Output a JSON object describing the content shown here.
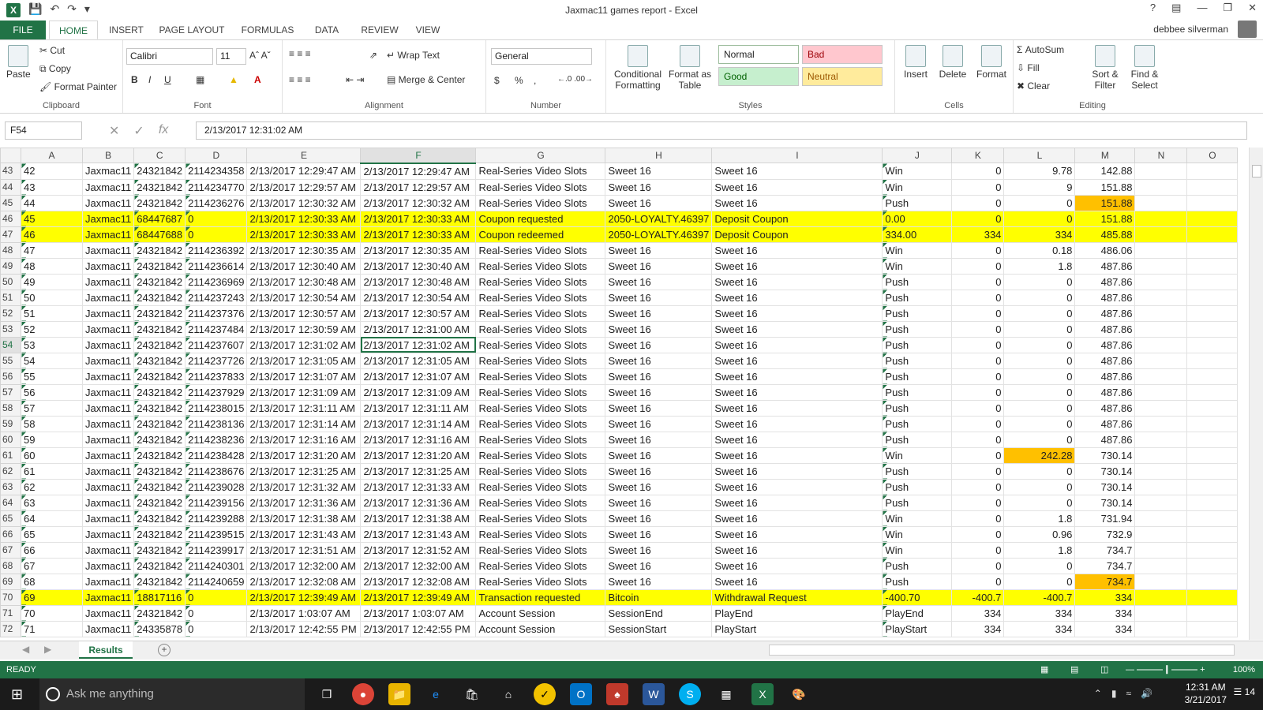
{
  "window": {
    "title": "Jaxmac11 games report - Excel",
    "user": "debbee silverman"
  },
  "tabs": [
    "FILE",
    "HOME",
    "INSERT",
    "PAGE LAYOUT",
    "FORMULAS",
    "DATA",
    "REVIEW",
    "VIEW"
  ],
  "ribbon": {
    "clipboard": {
      "label": "Clipboard",
      "paste": "Paste",
      "cut": "Cut",
      "copy": "Copy",
      "format_painter": "Format Painter"
    },
    "font": {
      "label": "Font",
      "name": "Calibri",
      "size": "11",
      "bold": "B",
      "italic": "I",
      "underline": "U"
    },
    "alignment": {
      "label": "Alignment",
      "wrap": "Wrap Text",
      "merge": "Merge & Center"
    },
    "number": {
      "label": "Number",
      "format": "General",
      "currency": "$",
      "percent": "%",
      "comma": ","
    },
    "styles": {
      "label": "Styles",
      "cond": "Conditional Formatting",
      "format_table": "Format as Table",
      "normal": "Normal",
      "bad": "Bad",
      "good": "Good",
      "neutral": "Neutral"
    },
    "cells": {
      "label": "Cells",
      "insert": "Insert",
      "delete": "Delete",
      "format": "Format"
    },
    "editing": {
      "label": "Editing",
      "autosum": "AutoSum",
      "fill": "Fill",
      "clear": "Clear",
      "sort": "Sort & Filter",
      "find": "Find & Select"
    }
  },
  "formula_bar": {
    "name_box": "F54",
    "formula": "2/13/2017 12:31:02 AM",
    "fx": "fx"
  },
  "columns": [
    "A",
    "B",
    "C",
    "D",
    "E",
    "F",
    "G",
    "H",
    "I",
    "J",
    "K",
    "L",
    "M",
    "N",
    "O"
  ],
  "rows": [
    {
      "r": "43",
      "c": [
        "42",
        "Jaxmac11",
        "24321842",
        "2114234358",
        "2/13/2017 12:29:47 AM",
        "2/13/2017 12:29:47 AM",
        "Real-Series Video Slots",
        "Sweet 16",
        "Sweet 16",
        "Win",
        "0",
        "9.78",
        "142.88"
      ]
    },
    {
      "r": "44",
      "c": [
        "43",
        "Jaxmac11",
        "24321842",
        "2114234770",
        "2/13/2017 12:29:57 AM",
        "2/13/2017 12:29:57 AM",
        "Real-Series Video Slots",
        "Sweet 16",
        "Sweet 16",
        "Win",
        "0",
        "9",
        "151.88"
      ]
    },
    {
      "r": "45",
      "c": [
        "44",
        "Jaxmac11",
        "24321842",
        "2114236276",
        "2/13/2017 12:30:32 AM",
        "2/13/2017 12:30:32 AM",
        "Real-Series Video Slots",
        "Sweet 16",
        "Sweet 16",
        "Push",
        "0",
        "0",
        "151.88"
      ],
      "orange": [
        12
      ]
    },
    {
      "r": "46",
      "c": [
        "45",
        "Jaxmac11",
        "68447687",
        "0",
        "2/13/2017 12:30:33 AM",
        "2/13/2017 12:30:33 AM",
        "Coupon requested",
        "2050-LOYALTY.46397",
        "Deposit Coupon",
        "0.00",
        "0",
        "0",
        "151.88"
      ],
      "hl": true
    },
    {
      "r": "47",
      "c": [
        "46",
        "Jaxmac11",
        "68447688",
        "0",
        "2/13/2017 12:30:33 AM",
        "2/13/2017 12:30:33 AM",
        "Coupon redeemed",
        "2050-LOYALTY.46397",
        "Deposit Coupon",
        "334.00",
        "334",
        "334",
        "485.88"
      ],
      "hl": true
    },
    {
      "r": "48",
      "c": [
        "47",
        "Jaxmac11",
        "24321842",
        "2114236392",
        "2/13/2017 12:30:35 AM",
        "2/13/2017 12:30:35 AM",
        "Real-Series Video Slots",
        "Sweet 16",
        "Sweet 16",
        "Win",
        "0",
        "0.18",
        "486.06"
      ]
    },
    {
      "r": "49",
      "c": [
        "48",
        "Jaxmac11",
        "24321842",
        "2114236614",
        "2/13/2017 12:30:40 AM",
        "2/13/2017 12:30:40 AM",
        "Real-Series Video Slots",
        "Sweet 16",
        "Sweet 16",
        "Win",
        "0",
        "1.8",
        "487.86"
      ]
    },
    {
      "r": "50",
      "c": [
        "49",
        "Jaxmac11",
        "24321842",
        "2114236969",
        "2/13/2017 12:30:48 AM",
        "2/13/2017 12:30:48 AM",
        "Real-Series Video Slots",
        "Sweet 16",
        "Sweet 16",
        "Push",
        "0",
        "0",
        "487.86"
      ]
    },
    {
      "r": "51",
      "c": [
        "50",
        "Jaxmac11",
        "24321842",
        "2114237243",
        "2/13/2017 12:30:54 AM",
        "2/13/2017 12:30:54 AM",
        "Real-Series Video Slots",
        "Sweet 16",
        "Sweet 16",
        "Push",
        "0",
        "0",
        "487.86"
      ]
    },
    {
      "r": "52",
      "c": [
        "51",
        "Jaxmac11",
        "24321842",
        "2114237376",
        "2/13/2017 12:30:57 AM",
        "2/13/2017 12:30:57 AM",
        "Real-Series Video Slots",
        "Sweet 16",
        "Sweet 16",
        "Push",
        "0",
        "0",
        "487.86"
      ]
    },
    {
      "r": "53",
      "c": [
        "52",
        "Jaxmac11",
        "24321842",
        "2114237484",
        "2/13/2017 12:30:59 AM",
        "2/13/2017 12:31:00 AM",
        "Real-Series Video Slots",
        "Sweet 16",
        "Sweet 16",
        "Push",
        "0",
        "0",
        "487.86"
      ]
    },
    {
      "r": "54",
      "c": [
        "53",
        "Jaxmac11",
        "24321842",
        "2114237607",
        "2/13/2017 12:31:02 AM",
        "2/13/2017 12:31:02 AM",
        "Real-Series Video Slots",
        "Sweet 16",
        "Sweet 16",
        "Push",
        "0",
        "0",
        "487.86"
      ],
      "active": true
    },
    {
      "r": "55",
      "c": [
        "54",
        "Jaxmac11",
        "24321842",
        "2114237726",
        "2/13/2017 12:31:05 AM",
        "2/13/2017 12:31:05 AM",
        "Real-Series Video Slots",
        "Sweet 16",
        "Sweet 16",
        "Push",
        "0",
        "0",
        "487.86"
      ]
    },
    {
      "r": "56",
      "c": [
        "55",
        "Jaxmac11",
        "24321842",
        "2114237833",
        "2/13/2017 12:31:07 AM",
        "2/13/2017 12:31:07 AM",
        "Real-Series Video Slots",
        "Sweet 16",
        "Sweet 16",
        "Push",
        "0",
        "0",
        "487.86"
      ]
    },
    {
      "r": "57",
      "c": [
        "56",
        "Jaxmac11",
        "24321842",
        "2114237929",
        "2/13/2017 12:31:09 AM",
        "2/13/2017 12:31:09 AM",
        "Real-Series Video Slots",
        "Sweet 16",
        "Sweet 16",
        "Push",
        "0",
        "0",
        "487.86"
      ]
    },
    {
      "r": "58",
      "c": [
        "57",
        "Jaxmac11",
        "24321842",
        "2114238015",
        "2/13/2017 12:31:11 AM",
        "2/13/2017 12:31:11 AM",
        "Real-Series Video Slots",
        "Sweet 16",
        "Sweet 16",
        "Push",
        "0",
        "0",
        "487.86"
      ]
    },
    {
      "r": "59",
      "c": [
        "58",
        "Jaxmac11",
        "24321842",
        "2114238136",
        "2/13/2017 12:31:14 AM",
        "2/13/2017 12:31:14 AM",
        "Real-Series Video Slots",
        "Sweet 16",
        "Sweet 16",
        "Push",
        "0",
        "0",
        "487.86"
      ]
    },
    {
      "r": "60",
      "c": [
        "59",
        "Jaxmac11",
        "24321842",
        "2114238236",
        "2/13/2017 12:31:16 AM",
        "2/13/2017 12:31:16 AM",
        "Real-Series Video Slots",
        "Sweet 16",
        "Sweet 16",
        "Push",
        "0",
        "0",
        "487.86"
      ]
    },
    {
      "r": "61",
      "c": [
        "60",
        "Jaxmac11",
        "24321842",
        "2114238428",
        "2/13/2017 12:31:20 AM",
        "2/13/2017 12:31:20 AM",
        "Real-Series Video Slots",
        "Sweet 16",
        "Sweet 16",
        "Win",
        "0",
        "242.28",
        "730.14"
      ],
      "orange": [
        11
      ]
    },
    {
      "r": "62",
      "c": [
        "61",
        "Jaxmac11",
        "24321842",
        "2114238676",
        "2/13/2017 12:31:25 AM",
        "2/13/2017 12:31:25 AM",
        "Real-Series Video Slots",
        "Sweet 16",
        "Sweet 16",
        "Push",
        "0",
        "0",
        "730.14"
      ]
    },
    {
      "r": "63",
      "c": [
        "62",
        "Jaxmac11",
        "24321842",
        "2114239028",
        "2/13/2017 12:31:32 AM",
        "2/13/2017 12:31:33 AM",
        "Real-Series Video Slots",
        "Sweet 16",
        "Sweet 16",
        "Push",
        "0",
        "0",
        "730.14"
      ]
    },
    {
      "r": "64",
      "c": [
        "63",
        "Jaxmac11",
        "24321842",
        "2114239156",
        "2/13/2017 12:31:36 AM",
        "2/13/2017 12:31:36 AM",
        "Real-Series Video Slots",
        "Sweet 16",
        "Sweet 16",
        "Push",
        "0",
        "0",
        "730.14"
      ]
    },
    {
      "r": "65",
      "c": [
        "64",
        "Jaxmac11",
        "24321842",
        "2114239288",
        "2/13/2017 12:31:38 AM",
        "2/13/2017 12:31:38 AM",
        "Real-Series Video Slots",
        "Sweet 16",
        "Sweet 16",
        "Win",
        "0",
        "1.8",
        "731.94"
      ]
    },
    {
      "r": "66",
      "c": [
        "65",
        "Jaxmac11",
        "24321842",
        "2114239515",
        "2/13/2017 12:31:43 AM",
        "2/13/2017 12:31:43 AM",
        "Real-Series Video Slots",
        "Sweet 16",
        "Sweet 16",
        "Win",
        "0",
        "0.96",
        "732.9"
      ]
    },
    {
      "r": "67",
      "c": [
        "66",
        "Jaxmac11",
        "24321842",
        "2114239917",
        "2/13/2017 12:31:51 AM",
        "2/13/2017 12:31:52 AM",
        "Real-Series Video Slots",
        "Sweet 16",
        "Sweet 16",
        "Win",
        "0",
        "1.8",
        "734.7"
      ]
    },
    {
      "r": "68",
      "c": [
        "67",
        "Jaxmac11",
        "24321842",
        "2114240301",
        "2/13/2017 12:32:00 AM",
        "2/13/2017 12:32:00 AM",
        "Real-Series Video Slots",
        "Sweet 16",
        "Sweet 16",
        "Push",
        "0",
        "0",
        "734.7"
      ]
    },
    {
      "r": "69",
      "c": [
        "68",
        "Jaxmac11",
        "24321842",
        "2114240659",
        "2/13/2017 12:32:08 AM",
        "2/13/2017 12:32:08 AM",
        "Real-Series Video Slots",
        "Sweet 16",
        "Sweet 16",
        "Push",
        "0",
        "0",
        "734.7"
      ],
      "orange": [
        12
      ]
    },
    {
      "r": "70",
      "c": [
        "69",
        "Jaxmac11",
        "18817116",
        "0",
        "2/13/2017 12:39:49 AM",
        "2/13/2017 12:39:49 AM",
        "Transaction requested",
        "Bitcoin",
        "Withdrawal Request",
        "-400.70",
        "-400.7",
        "-400.7",
        "334"
      ],
      "hl": true
    },
    {
      "r": "71",
      "c": [
        "70",
        "Jaxmac11",
        "24321842",
        "0",
        "2/13/2017 1:03:07 AM",
        "2/13/2017 1:03:07 AM",
        "Account Session",
        "SessionEnd",
        "PlayEnd",
        "PlayEnd",
        "334",
        "334",
        "334"
      ]
    },
    {
      "r": "72",
      "c": [
        "71",
        "Jaxmac11",
        "24335878",
        "0",
        "2/13/2017 12:42:55 PM",
        "2/13/2017 12:42:55 PM",
        "Account Session",
        "SessionStart",
        "PlayStart",
        "PlayStart",
        "334",
        "334",
        "334"
      ]
    }
  ],
  "sheet_tab": "Results",
  "status": {
    "ready": "READY",
    "zoom": "100%"
  },
  "taskbar": {
    "search_placeholder": "Ask me anything",
    "time": "12:31 AM",
    "date": "3/21/2017",
    "notifications": "14"
  },
  "colors": {
    "excel_green": "#217346",
    "highlight": "#ffff00",
    "orange": "#ffc000"
  }
}
